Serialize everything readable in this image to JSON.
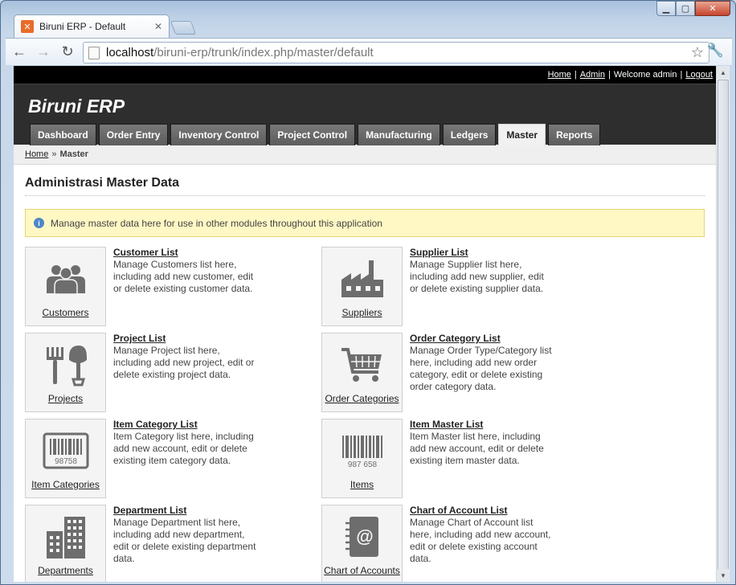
{
  "browser": {
    "tab_title": "Biruni ERP - Default",
    "tab_favicon": "xampp-icon",
    "url_prefix": "localhost",
    "url_path": "/biruni-erp/trunk/index.php/master/default"
  },
  "topbar": {
    "home": "Home",
    "admin": "Admin",
    "welcome": "Welcome admin",
    "logout": "Logout",
    "sep": "|"
  },
  "header": {
    "logo": "Biruni ERP",
    "nav": [
      {
        "label": "Dashboard"
      },
      {
        "label": "Order Entry"
      },
      {
        "label": "Inventory Control"
      },
      {
        "label": "Project Control"
      },
      {
        "label": "Manufacturing"
      },
      {
        "label": "Ledgers"
      },
      {
        "label": "Master"
      },
      {
        "label": "Reports"
      }
    ],
    "active": "Master"
  },
  "breadcrumb": {
    "home": "Home",
    "sep": "»",
    "current": "Master"
  },
  "page": {
    "title": "Administrasi Master Data",
    "notice": "Manage master data here for use in other modules throughout this application"
  },
  "items": [
    {
      "label": "Customers",
      "title": "Customer List",
      "desc": "Manage Customers list here, including add new customer, edit or delete existing customer data.",
      "icon": "customers-icon"
    },
    {
      "label": "Suppliers",
      "title": "Supplier List",
      "desc": "Manage Supplier list here, including add new supplier, edit or delete existing supplier data.",
      "icon": "factory-icon"
    },
    {
      "label": "Projects",
      "title": "Project List",
      "desc": "Manage Project list here, including add new project, edit or delete existing project data.",
      "icon": "tools-icon"
    },
    {
      "label": "Order Categories",
      "title": "Order Category List",
      "desc": "Manage Order Type/Category list here, including add new order category, edit or delete existing order category data.",
      "icon": "cart-icon"
    },
    {
      "label": "Item Categories",
      "title": "Item Category List",
      "desc": "Item Category list here, including add new account, edit or delete existing item category data.",
      "icon": "barcode-box-icon",
      "code": "98758"
    },
    {
      "label": "Items",
      "title": "Item Master List",
      "desc": "Item Master list here, including add new account, edit or delete existing item master data.",
      "icon": "barcode-icon",
      "code": "987 658"
    },
    {
      "label": "Departments",
      "title": "Department List",
      "desc": "Manage Department list here, including add new department, edit or delete existing department data.",
      "icon": "buildings-icon"
    },
    {
      "label": "Chart of Accounts",
      "title": "Chart of Account List",
      "desc": "Manage Chart of Account list here, including add new account, edit or delete existing account data.",
      "icon": "address-book-icon"
    }
  ]
}
